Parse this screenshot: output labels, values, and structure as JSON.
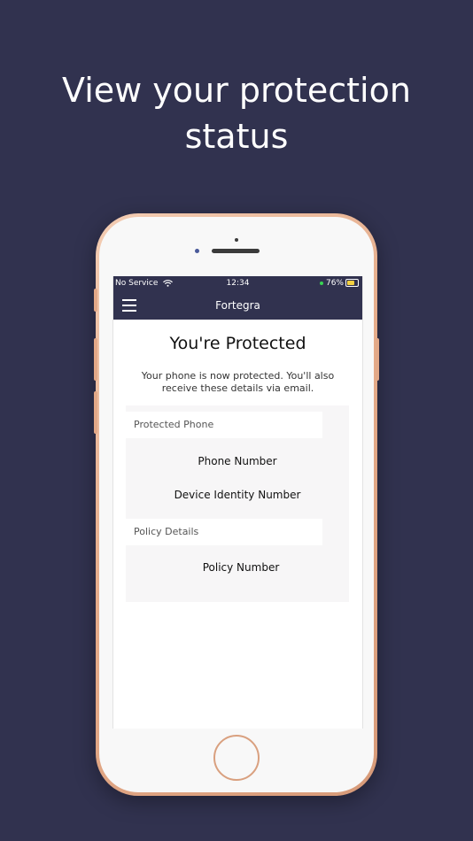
{
  "headline": {
    "line1": "View your protection",
    "line2": "status"
  },
  "status_bar": {
    "carrier": "No Service",
    "time": "12:34",
    "battery": "76%"
  },
  "nav": {
    "title": "Fortegra"
  },
  "content": {
    "title": "You're Protected",
    "intro": "Your phone is now protected. You'll also receive these details via email.",
    "sections": [
      {
        "header": "Protected Phone",
        "fields": [
          "Phone Number",
          "Device Identity Number"
        ]
      },
      {
        "header": "Policy Details",
        "fields": [
          "Policy Number"
        ]
      }
    ]
  },
  "colors": {
    "background": "#31324f",
    "nav_bar": "#31324f",
    "card": "#f7f6f7",
    "phone_frame": "#e5ac8a"
  }
}
